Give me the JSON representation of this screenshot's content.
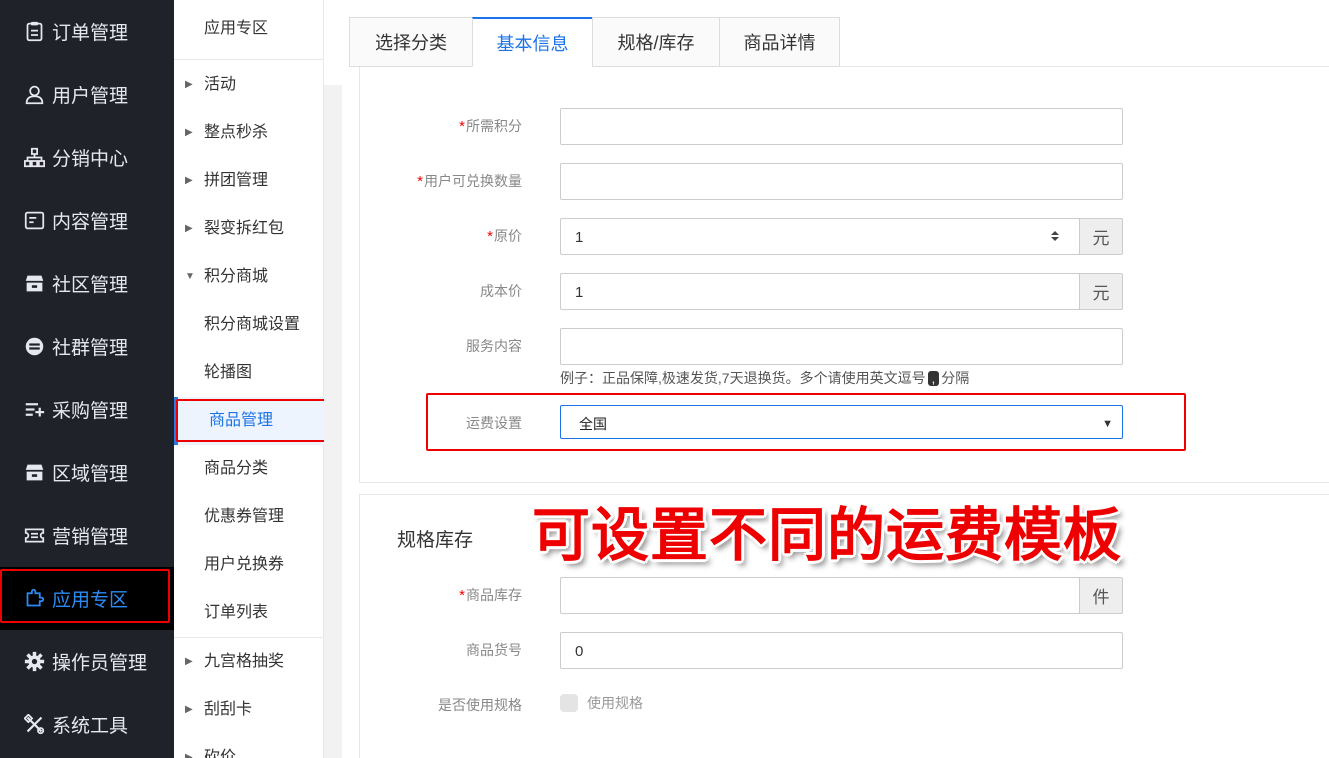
{
  "sidebar": {
    "items": [
      {
        "label": "订单管理",
        "icon": "clipboard-icon"
      },
      {
        "label": "用户管理",
        "icon": "user-icon"
      },
      {
        "label": "分销中心",
        "icon": "sitemap-icon"
      },
      {
        "label": "内容管理",
        "icon": "content-icon"
      },
      {
        "label": "社区管理",
        "icon": "store-icon"
      },
      {
        "label": "社群管理",
        "icon": "minus-circle-icon"
      },
      {
        "label": "采购管理",
        "icon": "list-add-icon"
      },
      {
        "label": "区域管理",
        "icon": "store-icon"
      },
      {
        "label": "营销管理",
        "icon": "ticket-icon"
      },
      {
        "label": "应用专区",
        "icon": "puzzle-icon",
        "active": true
      },
      {
        "label": "操作员管理",
        "icon": "gear-icon"
      },
      {
        "label": "系统工具",
        "icon": "tools-icon"
      }
    ]
  },
  "submenu": {
    "title": "应用专区",
    "items": [
      {
        "label": "活动",
        "group": true
      },
      {
        "label": "整点秒杀",
        "group": true
      },
      {
        "label": "拼团管理",
        "group": true
      },
      {
        "label": "裂变拆红包",
        "group": true
      },
      {
        "label": "积分商城",
        "group": true,
        "expanded": true
      },
      {
        "label": "积分商城设置"
      },
      {
        "label": "轮播图"
      },
      {
        "label": "商品管理",
        "active": true
      },
      {
        "label": "商品分类"
      },
      {
        "label": "优惠券管理"
      },
      {
        "label": "用户兑换券"
      },
      {
        "label": "订单列表"
      },
      {
        "label": "九宫格抽奖",
        "group": true
      },
      {
        "label": "刮刮卡",
        "group": true
      },
      {
        "label": "砍价",
        "group": true
      }
    ]
  },
  "tabs": [
    "选择分类",
    "基本信息",
    "规格/库存",
    "商品详情"
  ],
  "active_tab": "基本信息",
  "form": {
    "points_label": "所需积分",
    "points_value": "",
    "exchange_qty_label": "用户可兑换数量",
    "exchange_qty_value": "",
    "price_label": "原价",
    "price_value": "1",
    "price_unit": "元",
    "cost_label": "成本价",
    "cost_value": "1",
    "cost_unit": "元",
    "service_label": "服务内容",
    "service_value": "",
    "service_hint_pre": "例子：正品保障,极速发货,7天退换货。多个请使用英文逗号",
    "service_hint_comma": ",",
    "service_hint_post": "分隔",
    "shipping_label": "运费设置",
    "shipping_value": "全国"
  },
  "stock_section": {
    "title": "规格库存",
    "stock_label": "商品库存",
    "stock_value": "",
    "stock_unit": "件",
    "sku_label": "商品货号",
    "sku_value": "0",
    "use_spec_label": "是否使用规格",
    "use_spec_checkbox": "使用规格"
  },
  "annotation": "可设置不同的运费模板",
  "colors": {
    "sidebar_bg": "#20222a",
    "accent": "#1a73e8",
    "highlight_red": "#ee0000"
  }
}
